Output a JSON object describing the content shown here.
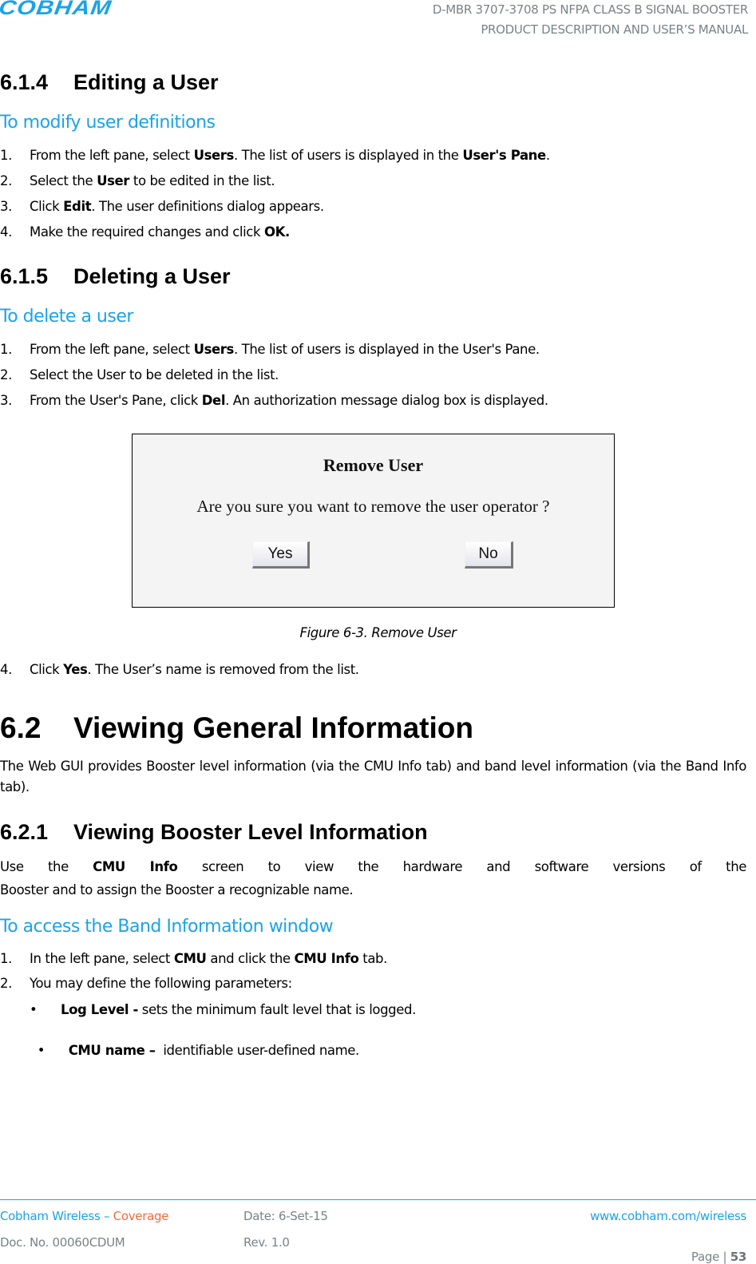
{
  "header": {
    "logo_text": "COBHAM",
    "doc_title_line1": "D-MBR 3707-3708 PS NFPA CLASS B SIGNAL BOOSTER",
    "doc_title_line2": "PRODUCT DESCRIPTION AND USER’S MANUAL"
  },
  "section_614": {
    "number": "6.1.4",
    "title": "Editing a User",
    "procedure_title": "To modify user definitions",
    "steps": [
      {
        "n": "1.",
        "pre": "From the left pane, select ",
        "b1": "Users",
        "mid": ". The list of users is displayed in the ",
        "b2": "User's Pane",
        "post": "."
      },
      {
        "n": "2.",
        "pre": "Select the ",
        "b1": "User",
        "post": " to be edited in the list."
      },
      {
        "n": "3.",
        "pre": "Click ",
        "b1": "Edit",
        "post": ". The user definitions dialog appears."
      },
      {
        "n": "4.",
        "pre": "Make the required changes and click ",
        "b1": "OK."
      }
    ]
  },
  "section_615": {
    "number": "6.1.5",
    "title": "Deleting a User",
    "procedure_title": "To delete a user",
    "steps": [
      {
        "n": "1.",
        "pre": "From the left pane, select ",
        "b1": "Users",
        "post": ". The list of users is displayed in the User's Pane."
      },
      {
        "n": "2.",
        "pre": "Select the User to be deleted in the list."
      },
      {
        "n": "3.",
        "pre": "From the User's Pane, click ",
        "b1": "Del",
        "post": ". An authorization message dialog box is displayed."
      },
      {
        "n": "4.",
        "pre": "Click ",
        "b1": "Yes",
        "post": ". The User’s name is removed from the list."
      }
    ],
    "figure": {
      "dialog_title": "Remove User",
      "dialog_message": "Are you sure you want to remove the user operator ?",
      "yes_label": "Yes",
      "no_label": "No",
      "caption": "Figure 6-3. Remove User"
    }
  },
  "section_62": {
    "number": "6.2",
    "title": "Viewing General Information",
    "intro": "The Web GUI provides Booster level information (via the CMU Info tab) and band level information (via the Band Info tab)."
  },
  "section_621": {
    "number": "6.2.1",
    "title": "Viewing Booster Level Information",
    "intro_pre": "Use the ",
    "intro_bold": "CMU Info",
    "intro_post_line1": " screen to view the hardware and software versions of the",
    "intro_line2": "Booster and to assign the Booster a recognizable name.",
    "procedure_title": "To access the Band Information window",
    "steps": [
      {
        "n": "1.",
        "pre": "In the left pane, select ",
        "b1": "CMU",
        "mid": " and click the ",
        "b2": "CMU Info",
        "post": " tab."
      },
      {
        "n": "2.",
        "pre": "You may define the following parameters:"
      }
    ],
    "bullets": [
      {
        "bold": "Log Level -",
        "text": " sets the minimum fault level that is logged."
      },
      {
        "bold": "CMU name –",
        "text": "  identifiable user-defined name."
      }
    ]
  },
  "footer": {
    "company": "Cobham Wireless – ",
    "division": "Coverage",
    "date": "Date: 6-Set-15",
    "website": "www.cobham.com/wireless",
    "doc_no": "Doc. No. 00060CDUM",
    "rev": "Rev. 1.0",
    "page_label": "Page | ",
    "page_number": "53"
  }
}
